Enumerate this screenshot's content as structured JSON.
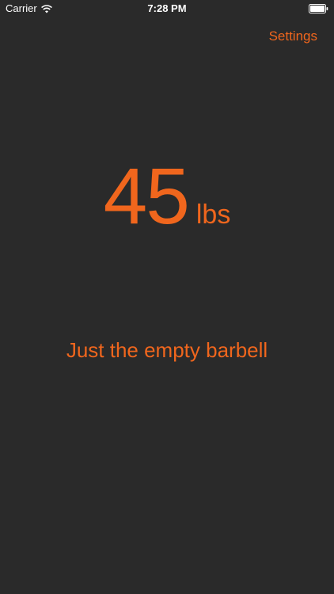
{
  "status_bar": {
    "carrier": "Carrier",
    "time": "7:28 PM",
    "wifi_icon": "wifi-icon",
    "battery_icon": "battery-icon"
  },
  "nav": {
    "settings_label": "Settings"
  },
  "weight": {
    "value": "45",
    "unit": "lbs"
  },
  "description": "Just the empty barbell",
  "colors": {
    "accent": "#f0661d",
    "background": "#2a2a2a",
    "status_text": "#ffffff"
  }
}
